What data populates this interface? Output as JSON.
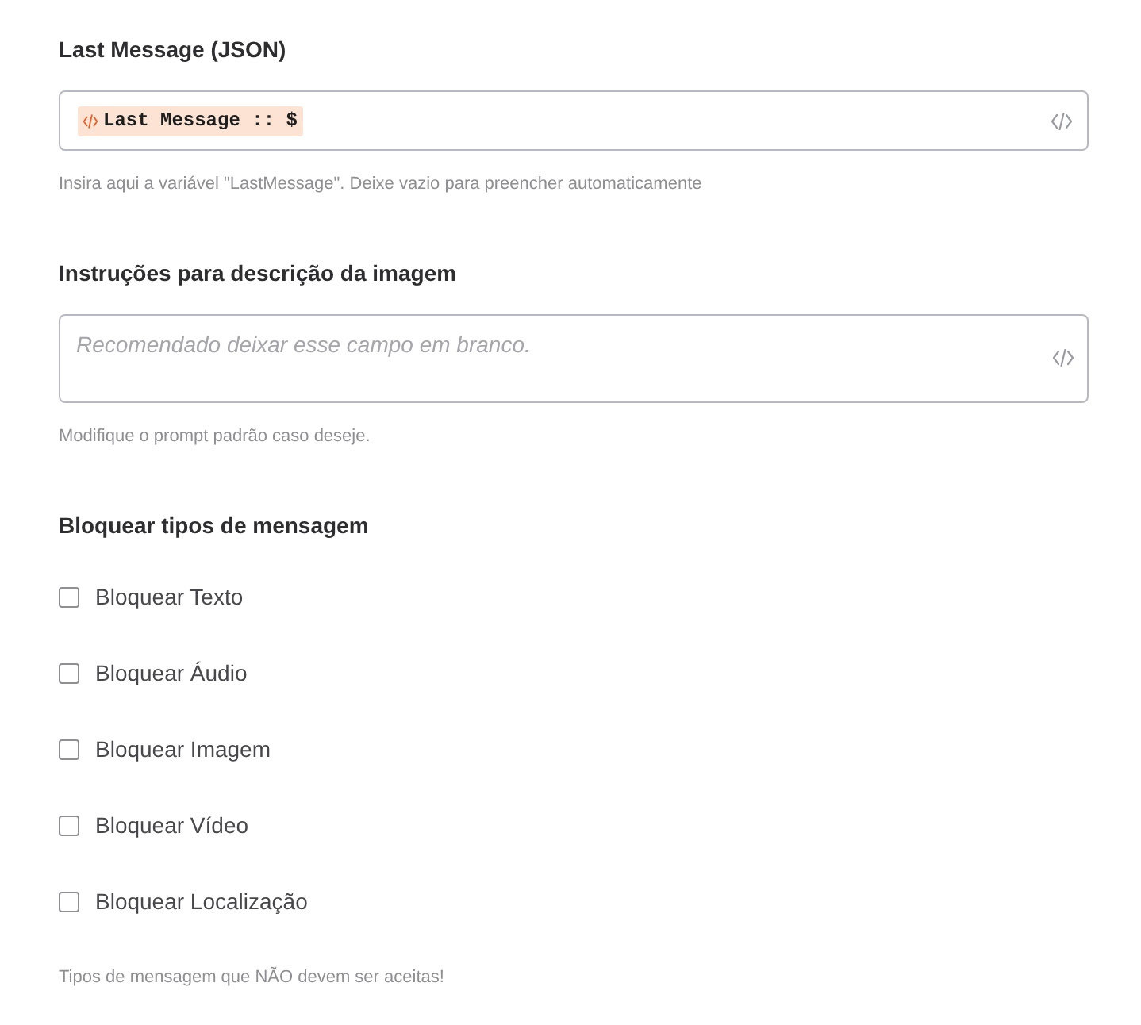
{
  "variable_field": {
    "label": "Last Message (JSON)",
    "token": "Last Message :: $",
    "hint": "Insira aqui a variável \"LastMessage\". Deixe vazio para preencher automaticamente"
  },
  "prompt_field": {
    "label": "Instruções para descrição da imagem",
    "placeholder": "Recomendado deixar esse campo em branco.",
    "hint": "Modifique o prompt padrão caso deseje."
  },
  "block_group": {
    "label": "Bloquear tipos de mensagem",
    "options": [
      {
        "label": "Bloquear Texto",
        "checked": false
      },
      {
        "label": "Bloquear Áudio",
        "checked": false
      },
      {
        "label": "Bloquear Imagem",
        "checked": false
      },
      {
        "label": "Bloquear Vídeo",
        "checked": false
      },
      {
        "label": "Bloquear Localização",
        "checked": false
      }
    ],
    "hint": "Tipos de mensagem que NÃO devem ser aceitas!"
  }
}
